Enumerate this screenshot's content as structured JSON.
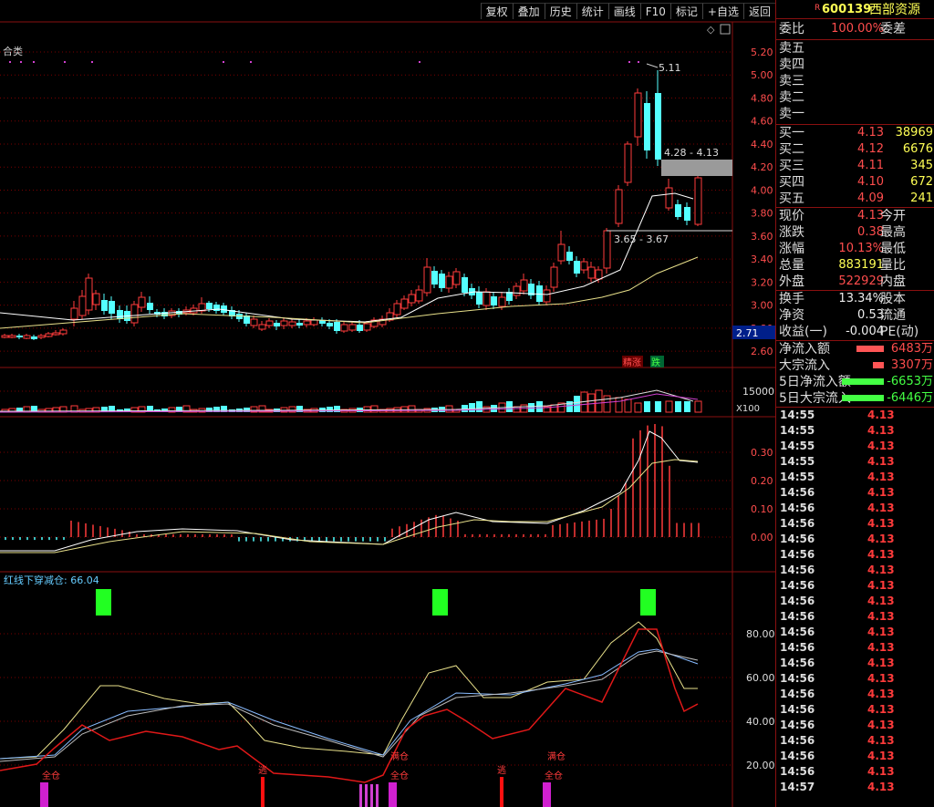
{
  "toolbar": {
    "buttons": [
      "复权",
      "叠加",
      "历史",
      "统计",
      "画线",
      "F10",
      "标记",
      "+自选",
      "返回"
    ]
  },
  "stock": {
    "code": "600139",
    "name": "西部资源"
  },
  "chart": {
    "indicator_label": "合类",
    "price_axis": [
      "5.20",
      "5.00",
      "4.80",
      "4.60",
      "4.40",
      "4.20",
      "4.00",
      "3.80",
      "3.60",
      "3.40",
      "3.20",
      "3.00",
      "2.80",
      "2.60"
    ],
    "price_marker": "2.71",
    "annot_high": "5.11",
    "annot_range1": "4.28 - 4.13",
    "annot_range2": "3.65 - 3.67",
    "tag_up": "精涨",
    "tag_down": "跌",
    "vol_axis": "15000",
    "vol_unit": "X100",
    "macd_axis": [
      "0.30",
      "0.20",
      "0.10",
      "0.00"
    ],
    "kdj_title": "红线下穿减仓: 66.04",
    "kdj_axis": [
      "80.00",
      "60.00",
      "40.00",
      "20.00"
    ],
    "signal_full": "全仓",
    "signal_half": "满仓",
    "signal_escape": "逃"
  },
  "sidebar": {
    "webi": {
      "label": "委比",
      "value": "100.00%",
      "extra": "委差"
    },
    "sells": [
      "卖五",
      "卖四",
      "卖三",
      "卖二",
      "卖一"
    ],
    "buys": [
      {
        "label": "买一",
        "price": "4.13",
        "vol": "38969"
      },
      {
        "label": "买二",
        "price": "4.12",
        "vol": "6676"
      },
      {
        "label": "买三",
        "price": "4.11",
        "vol": "345"
      },
      {
        "label": "买四",
        "price": "4.10",
        "vol": "672"
      },
      {
        "label": "买五",
        "price": "4.09",
        "vol": "241"
      }
    ],
    "stats": [
      {
        "label": "现价",
        "value": "4.13",
        "extra": "今开"
      },
      {
        "label": "涨跌",
        "value": "0.38",
        "extra": "最高"
      },
      {
        "label": "涨幅",
        "value": "10.13%",
        "extra": "最低"
      },
      {
        "label": "总量",
        "value": "883191",
        "extra": "量比"
      },
      {
        "label": "外盘",
        "value": "522929",
        "extra": "内盘"
      }
    ],
    "stats2": [
      {
        "label": "换手",
        "value": "13.34%",
        "extra": "股本"
      },
      {
        "label": "净资",
        "value": "0.53",
        "extra": "流通"
      },
      {
        "label": "收益(一)",
        "value": "-0.004",
        "extra": "PE(动)"
      }
    ],
    "flows": [
      {
        "label": "净流入额",
        "value": "6483万",
        "color": "#ff5555",
        "dir": "red"
      },
      {
        "label": "大宗流入",
        "value": "3307万",
        "color": "#ff5555",
        "dir": "red"
      },
      {
        "label": "5日净流入额",
        "value": "-6653万",
        "color": "#44ff44",
        "dir": "grn"
      },
      {
        "label": "5日大宗流入",
        "value": "-6446万",
        "color": "#44ff44",
        "dir": "grn"
      }
    ],
    "ticks": [
      {
        "t": "14:55",
        "p": "4.13"
      },
      {
        "t": "14:55",
        "p": "4.13"
      },
      {
        "t": "14:55",
        "p": "4.13"
      },
      {
        "t": "14:55",
        "p": "4.13"
      },
      {
        "t": "14:55",
        "p": "4.13"
      },
      {
        "t": "14:56",
        "p": "4.13"
      },
      {
        "t": "14:56",
        "p": "4.13"
      },
      {
        "t": "14:56",
        "p": "4.13"
      },
      {
        "t": "14:56",
        "p": "4.13"
      },
      {
        "t": "14:56",
        "p": "4.13"
      },
      {
        "t": "14:56",
        "p": "4.13"
      },
      {
        "t": "14:56",
        "p": "4.13"
      },
      {
        "t": "14:56",
        "p": "4.13"
      },
      {
        "t": "14:56",
        "p": "4.13"
      },
      {
        "t": "14:56",
        "p": "4.13"
      },
      {
        "t": "14:56",
        "p": "4.13"
      },
      {
        "t": "14:56",
        "p": "4.13"
      },
      {
        "t": "14:56",
        "p": "4.13"
      },
      {
        "t": "14:56",
        "p": "4.13"
      },
      {
        "t": "14:56",
        "p": "4.13"
      },
      {
        "t": "14:56",
        "p": "4.13"
      },
      {
        "t": "14:56",
        "p": "4.13"
      },
      {
        "t": "14:56",
        "p": "4.13"
      },
      {
        "t": "14:56",
        "p": "4.13"
      },
      {
        "t": "14:57",
        "p": "4.13"
      }
    ]
  },
  "colors": {
    "up": "#ff3b3b",
    "down": "#54ffff",
    "ma1": "#ffffff",
    "ma2": "#e8e08a",
    "grid": "#7a0000"
  }
}
